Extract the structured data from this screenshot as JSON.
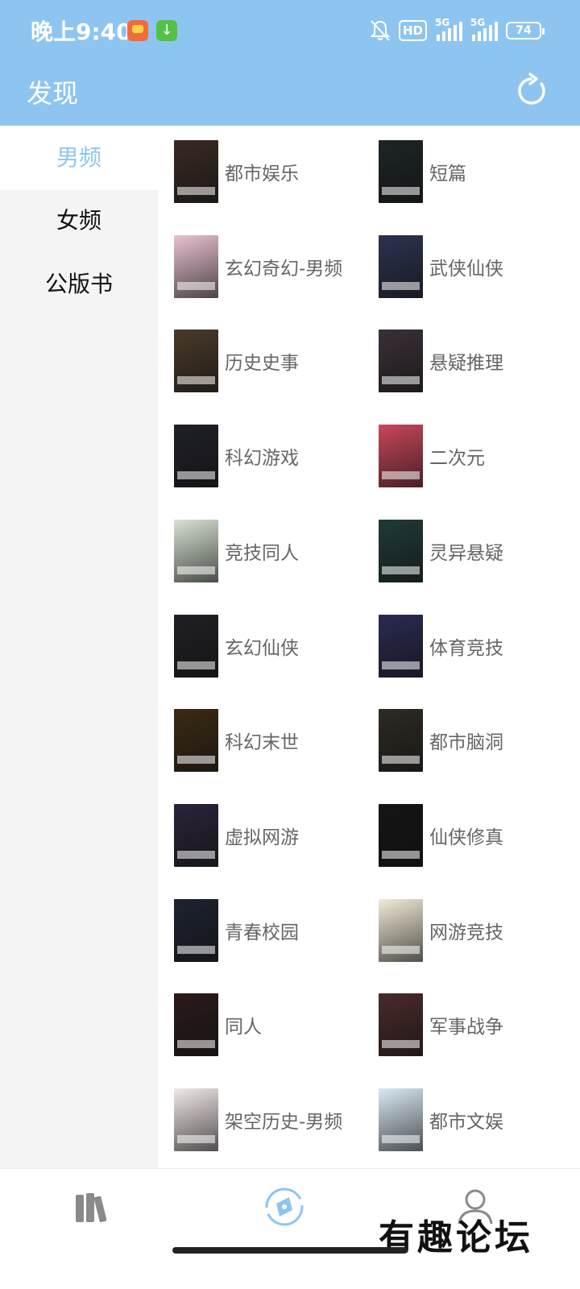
{
  "status_bar": {
    "time": "晚上9:40",
    "hd_label": "HD",
    "network_1": "5G",
    "network_2": "5G",
    "battery": "74"
  },
  "header": {
    "title": "发现"
  },
  "sidebar": {
    "tabs": [
      {
        "label": "男频",
        "active": true
      },
      {
        "label": "女频",
        "active": false
      },
      {
        "label": "公版书",
        "active": false
      }
    ]
  },
  "categories": [
    {
      "label": "都市娱乐",
      "cover_color": "#3a2a22"
    },
    {
      "label": "短篇",
      "cover_color": "#1e2426"
    },
    {
      "label": "玄幻奇幻-男频",
      "cover_color": "#e9c2d2"
    },
    {
      "label": "武侠仙侠",
      "cover_color": "#2b3350"
    },
    {
      "label": "历史史事",
      "cover_color": "#4a3a2a"
    },
    {
      "label": "悬疑推理",
      "cover_color": "#3a3038"
    },
    {
      "label": "科幻游戏",
      "cover_color": "#1f1f28"
    },
    {
      "label": "二次元",
      "cover_color": "#c9475a"
    },
    {
      "label": "竞技同人",
      "cover_color": "#d8e2d2"
    },
    {
      "label": "灵异悬疑",
      "cover_color": "#1f3a38"
    },
    {
      "label": "玄幻仙侠",
      "cover_color": "#202024"
    },
    {
      "label": "体育竞技",
      "cover_color": "#2a2a52"
    },
    {
      "label": "科幻末世",
      "cover_color": "#3b2a14"
    },
    {
      "label": "都市脑洞",
      "cover_color": "#2e2a24"
    },
    {
      "label": "虚拟网游",
      "cover_color": "#2a2338"
    },
    {
      "label": "仙侠修真",
      "cover_color": "#141414"
    },
    {
      "label": "青春校园",
      "cover_color": "#1e2230"
    },
    {
      "label": "网游竞技",
      "cover_color": "#f2ebd8"
    },
    {
      "label": "同人",
      "cover_color": "#2a1a1a"
    },
    {
      "label": "军事战争",
      "cover_color": "#4a2a2a"
    },
    {
      "label": "架空历史-男频",
      "cover_color": "#f3e8e8"
    },
    {
      "label": "都市文娱",
      "cover_color": "#d9e9f2"
    }
  ],
  "bottom_nav": {
    "items": [
      {
        "icon": "bookshelf-icon",
        "active": false
      },
      {
        "icon": "compass-icon",
        "active": true
      },
      {
        "icon": "user-icon",
        "active": false
      }
    ]
  },
  "watermark": "有趣论坛",
  "colors": {
    "accent": "#8ec5f0",
    "label_text": "#666666",
    "sidebar_bg": "#f4f4f4"
  }
}
